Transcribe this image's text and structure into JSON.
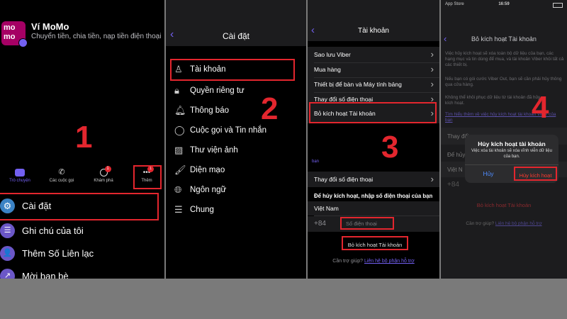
{
  "panel1": {
    "app_logo_text": "mo mo",
    "app_name": "Ví MoMo",
    "app_subtitle": "Chuyển tiền, chia tiền, nạp tiền điện thoại",
    "tabs": [
      {
        "label": "Trò chuyện",
        "icon": "chat-icon"
      },
      {
        "label": "Các cuộc gọi",
        "icon": "phone-icon"
      },
      {
        "label": "Khám phá",
        "icon": "explore-icon",
        "badge": "1"
      },
      {
        "label": "Thêm",
        "icon": "more-icon",
        "badge": "1"
      }
    ],
    "menu": [
      {
        "label": "Cài đặt",
        "icon": "gear-icon",
        "color": "#3b82c4"
      },
      {
        "label": "Ghi chú của tôi",
        "icon": "notes-icon",
        "color": "#6b57c7"
      },
      {
        "label": "Thêm Số Liên lạc",
        "icon": "add-contact-icon",
        "color": "#6b57c7"
      },
      {
        "label": "Mời bạn bè",
        "icon": "share-icon",
        "color": "#6b57c7"
      }
    ],
    "step": "1"
  },
  "panel2": {
    "title": "Cài đặt",
    "items": [
      {
        "label": "Tài khoản",
        "icon": "person-icon"
      },
      {
        "label": "Quyền riêng tư",
        "icon": "lock-icon"
      },
      {
        "label": "Thông báo",
        "icon": "bell-icon"
      },
      {
        "label": "Cuộc gọi và Tin nhắn",
        "icon": "message-icon"
      },
      {
        "label": "Thư viện ảnh",
        "icon": "image-icon"
      },
      {
        "label": "Diện mạo",
        "icon": "appearance-icon"
      },
      {
        "label": "Ngôn ngữ",
        "icon": "globe-icon"
      },
      {
        "label": "Chung",
        "icon": "list-icon"
      }
    ],
    "step": "2"
  },
  "panel3": {
    "title": "Tài khoản",
    "items": [
      {
        "label": "Sao lưu Viber"
      },
      {
        "label": "Mua hàng"
      },
      {
        "label": "Thiết bị để bàn và Máy tính bảng"
      },
      {
        "label": "Thay đổi số điện thoại"
      },
      {
        "label": "Bỏ kích hoạt Tài khoản"
      }
    ],
    "partial_text": "bạn",
    "change_phone": "Thay đổi số điện thoại",
    "instruction": "Để hủy kích hoạt, nhập số điện thoại của bạn",
    "country": "Việt Nam",
    "country_code": "+84",
    "phone_placeholder": "Số điện thoại",
    "deactivate_button": "Bỏ kích hoạt Tài khoản",
    "help_prefix": "Cần trợ giúp?",
    "help_link": "Liên hệ bộ phận hỗ trợ",
    "step": "3"
  },
  "panel4": {
    "status_left": "App Store",
    "status_time": "16:59",
    "title": "Bỏ kích hoạt Tài khoản",
    "desc1": "Việc hủy kích hoạt sẽ xóa toàn bộ dữ liệu của bạn, các hạng mục và tin dùng để mua, và tài khoản Viber khỏi tất cả các thiết bị.",
    "desc2": "Nếu bạn có gói cước Viber Out, bạn sẽ cần phải hủy thông qua cửa hàng.",
    "desc3": "Không thể khôi phục dữ liệu từ tài khoản đã hủy kích hoạt.",
    "link": "Tìm hiểu thêm về việc hủy kích hoạt tài khoản Viber của bạn",
    "bg_row1": "Thay đổi",
    "bg_row2": "Để hủy",
    "bg_row3": "Việt N",
    "bg_code": "+84",
    "bg_deactivate": "Bỏ kích hoạt Tài khoản",
    "help_prefix": "Cần trợ giúp?",
    "help_link": "Liên hệ bộ phận hỗ trợ",
    "dialog": {
      "title": "Hủy kích hoạt tài khoản",
      "message": "Việc xóa tài khoản sẽ xóa vĩnh viễn dữ liệu của bạn.",
      "cancel": "Hủy",
      "confirm": "Hủy kích hoạt"
    },
    "step": "4"
  }
}
